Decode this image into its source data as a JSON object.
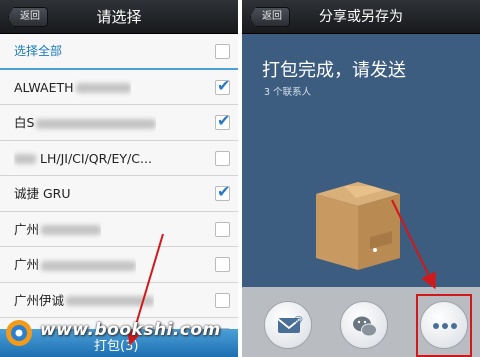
{
  "left": {
    "back_label": "返回",
    "title": "请选择",
    "select_all_label": "选择全部",
    "select_all_checked": false,
    "contacts": [
      {
        "label": "ALWAETH",
        "checked": true
      },
      {
        "label": "白S",
        "checked": true
      },
      {
        "label": "LH/JI/CI/QR/EY/C...",
        "checked": false
      },
      {
        "label": "诚捷 GRU",
        "checked": true
      },
      {
        "label": "广州",
        "checked": false
      },
      {
        "label": "广州",
        "checked": false
      },
      {
        "label": "广州伊诚",
        "checked": false
      },
      {
        "label": "",
        "checked": false
      }
    ],
    "pack_button_label": "打包(3)"
  },
  "right": {
    "back_label": "返回",
    "title": "分享或另存为",
    "heading": "打包完成，请发送",
    "subheading": "3 个联系人",
    "share_options": [
      {
        "icon": "mail-icon"
      },
      {
        "icon": "wechat-icon"
      },
      {
        "icon": "more-icon"
      }
    ]
  },
  "watermark": "www.bookshi.com",
  "colors": {
    "accent_blue": "#1a7bbd",
    "right_background": "#3d5d80",
    "arrow_red": "#d0191b"
  }
}
